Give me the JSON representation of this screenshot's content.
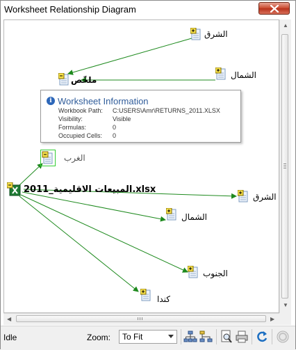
{
  "window": {
    "title": "Worksheet Relationship Diagram"
  },
  "diagram": {
    "workbook": {
      "label": "المبيعات الاقليمية_2011.xlsx"
    },
    "nodes": [
      {
        "id": "top-east",
        "label": "الشرق"
      },
      {
        "id": "top-north",
        "label": "الشمال"
      },
      {
        "id": "summary",
        "label": "ملخّص"
      },
      {
        "id": "west",
        "label": "الغرب"
      },
      {
        "id": "right-east",
        "label": "الشرق"
      },
      {
        "id": "mid-north",
        "label": "الشمال"
      },
      {
        "id": "south",
        "label": "الجنوب"
      },
      {
        "id": "canada",
        "label": "كندا"
      }
    ],
    "edge_color": "#1e8a1e"
  },
  "tooltip": {
    "title": "Worksheet Information",
    "rows": [
      {
        "key": "Workbook Path:",
        "value": "C:USERS\\Amr\\RETURNS_2011.XLSX"
      },
      {
        "key": "Visibility:",
        "value": "Visible"
      },
      {
        "key": "Formulas:",
        "value": "0"
      },
      {
        "key": "Occupied Cells:",
        "value": "0"
      }
    ]
  },
  "statusbar": {
    "status": "Idle",
    "zoom_label": "Zoom:",
    "zoom_value": "To Fit",
    "tools": [
      "hierarchy-icon",
      "layout-icon",
      "print-preview-icon",
      "print-icon",
      "refresh-icon",
      "stop-icon"
    ]
  }
}
